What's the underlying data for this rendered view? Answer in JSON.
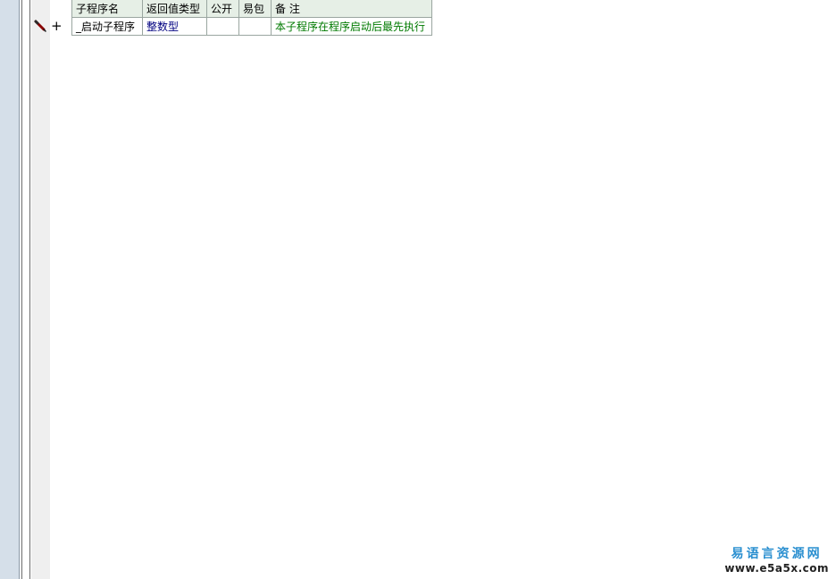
{
  "table": {
    "headers": {
      "name": "子程序名",
      "return_type": "返回值类型",
      "public": "公开",
      "package": "易包",
      "note": "备 注"
    },
    "rows": [
      {
        "name": "_启动子程序",
        "return_type": "整数型",
        "public": "",
        "package": "",
        "note": "本子程序在程序启动后最先执行"
      }
    ]
  },
  "gutter": {
    "row_marker_icon": "pencil-icon",
    "expand_icon": "plus-icon",
    "expand_glyph": "+"
  },
  "watermark": {
    "name": "易语言资源网",
    "url": "www.e5a5x.com"
  },
  "colors": {
    "header_bg": "#e6efe6",
    "return_type_text": "#000080",
    "note_text": "#007a00",
    "gutter_bg": "#d5dfe9",
    "watermark_blue": "#2a8fd0"
  }
}
